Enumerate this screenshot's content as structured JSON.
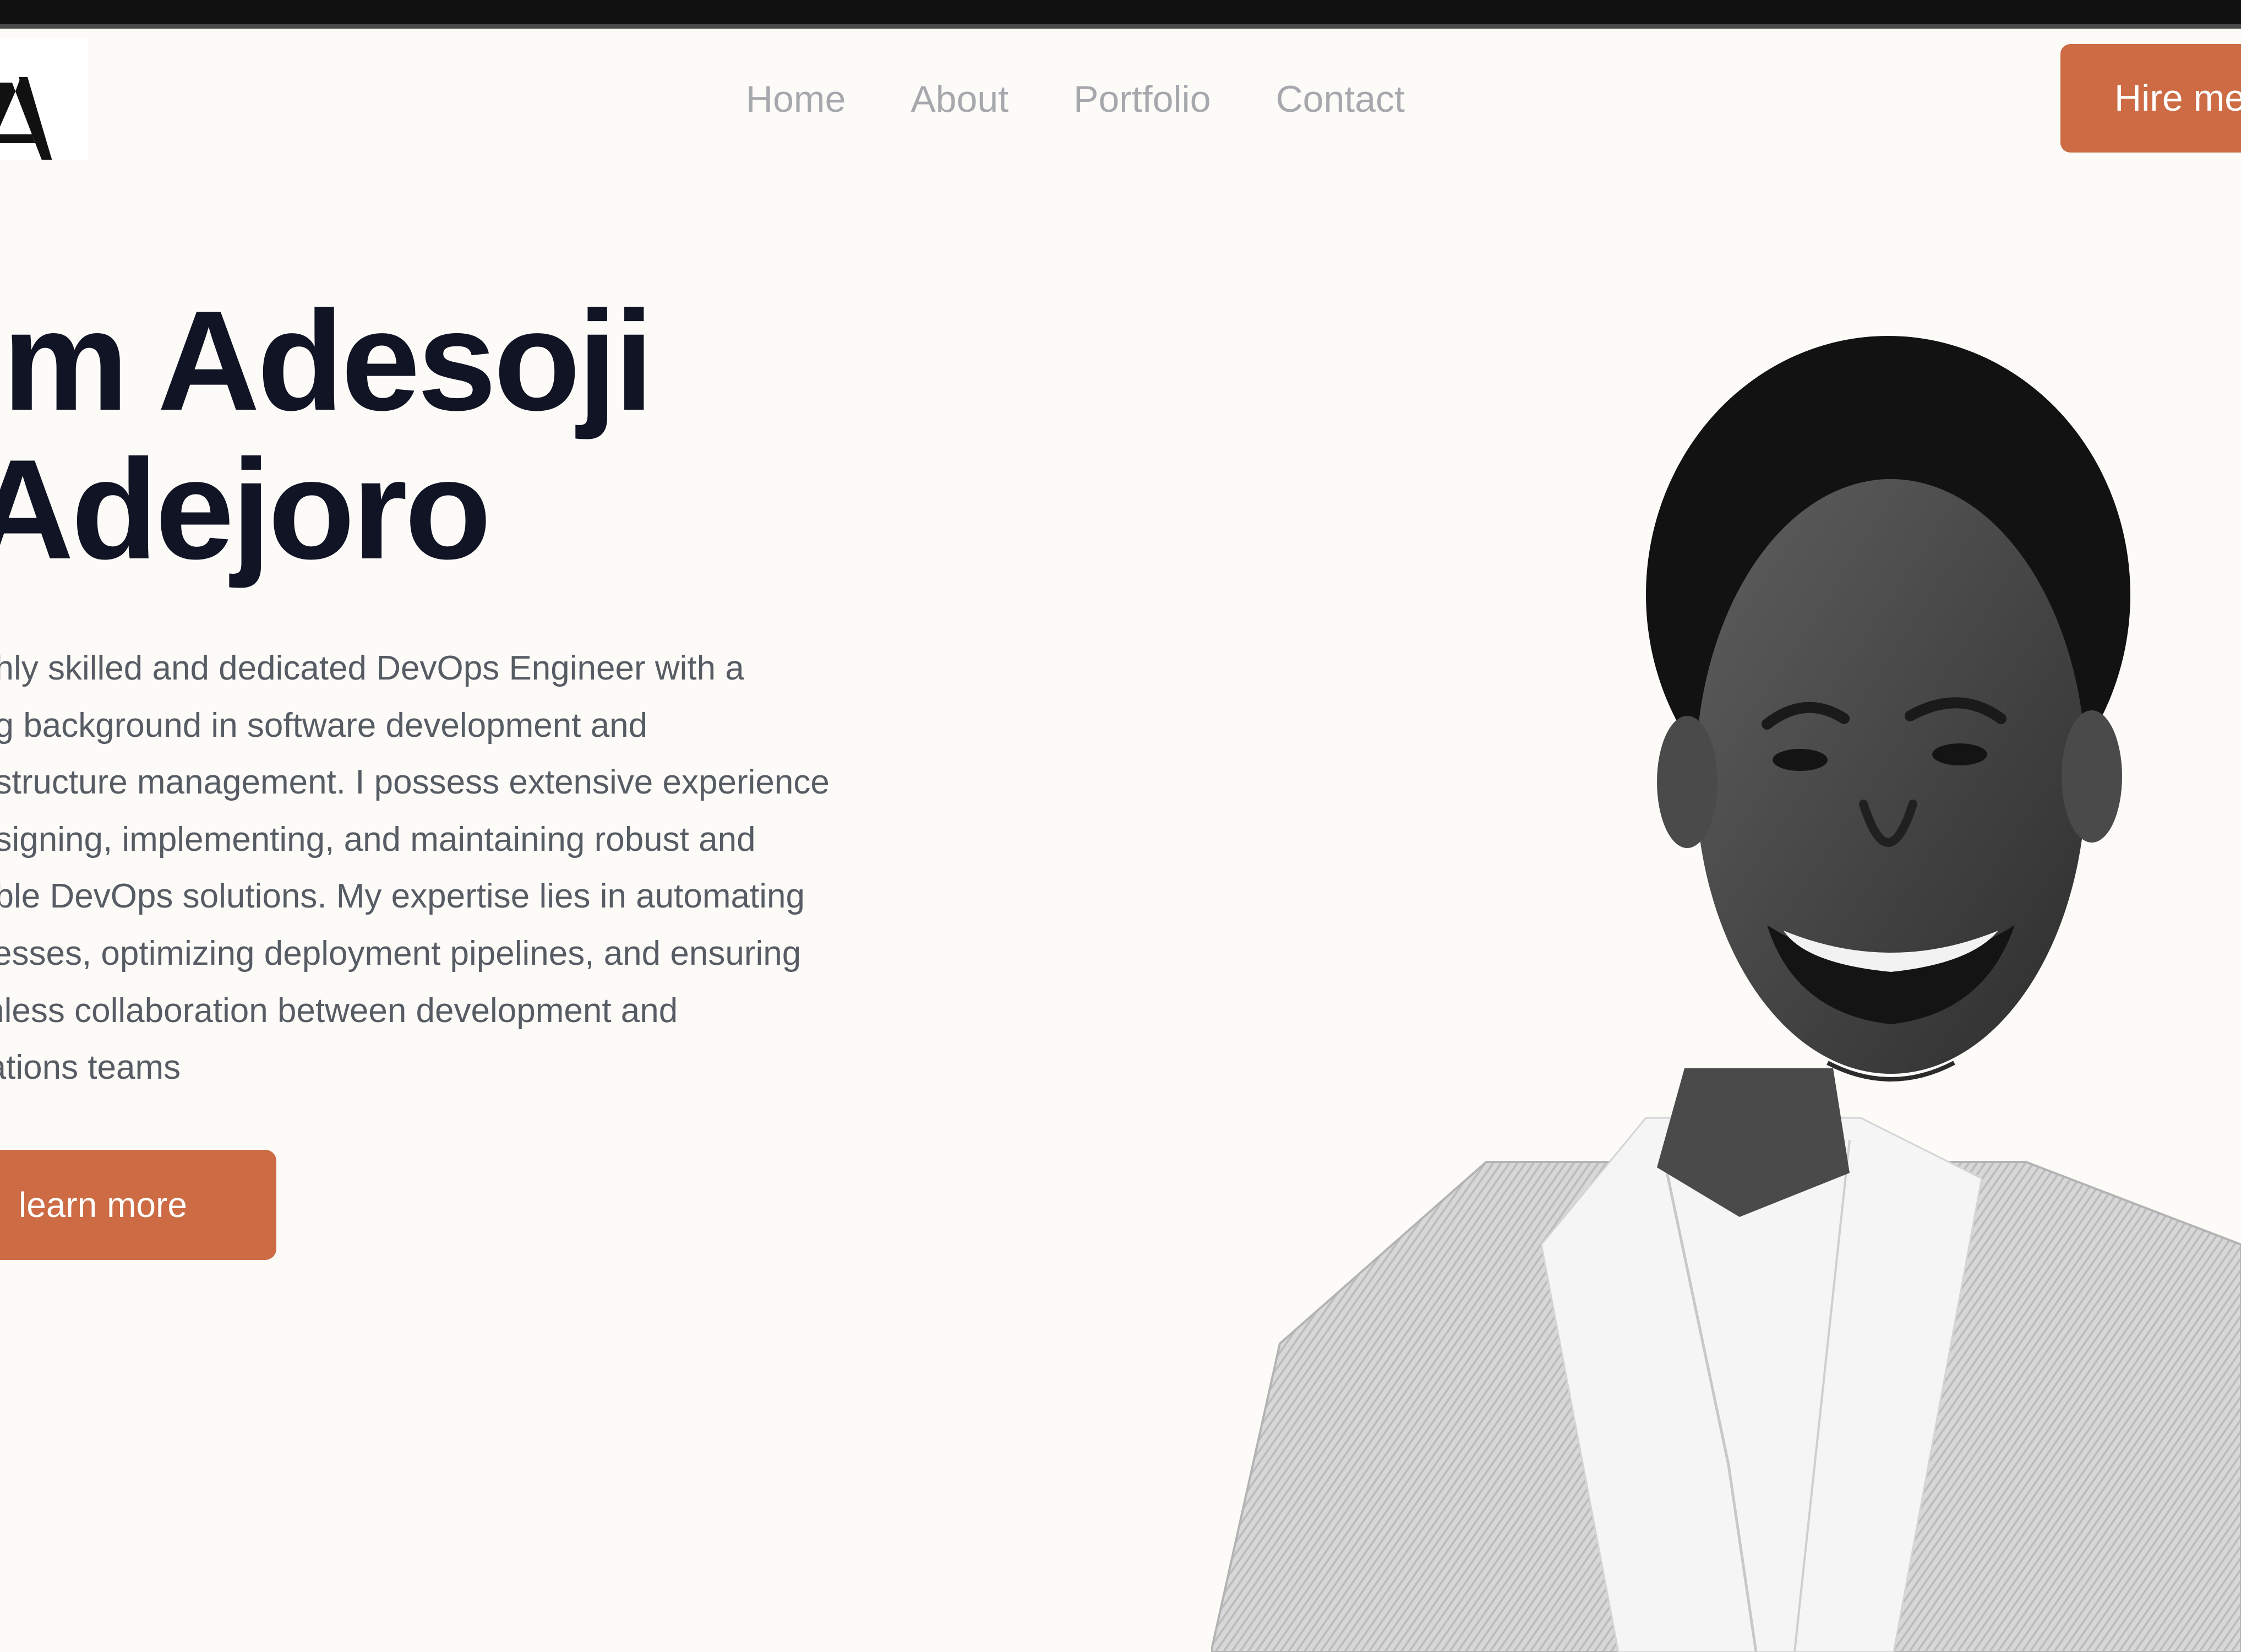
{
  "page": {
    "accent_color": "#cc6b44",
    "background_color": "#fcfbf8"
  },
  "header": {
    "logo_icon": "monogram-logo-icon",
    "nav": [
      {
        "label": "Home"
      },
      {
        "label": "About"
      },
      {
        "label": "Portfolio"
      },
      {
        "label": "Contact"
      }
    ],
    "hire_label": "Hire me"
  },
  "hero": {
    "title_line1": "'m Adesoji",
    "title_line2": "Adejoro",
    "description_lines": [
      "ghly skilled and dedicated DevOps Engineer with a",
      "ng background in software development and",
      "astructure management. I possess extensive experience",
      "esigning, implementing, and maintaining robust and",
      "able DevOps solutions. My expertise lies in automating",
      "cesses, optimizing deployment pipelines, and ensuring",
      "mless collaboration between development and",
      "rations teams"
    ],
    "cta_label": "learn more",
    "portrait_icon": "portrait-photo"
  }
}
